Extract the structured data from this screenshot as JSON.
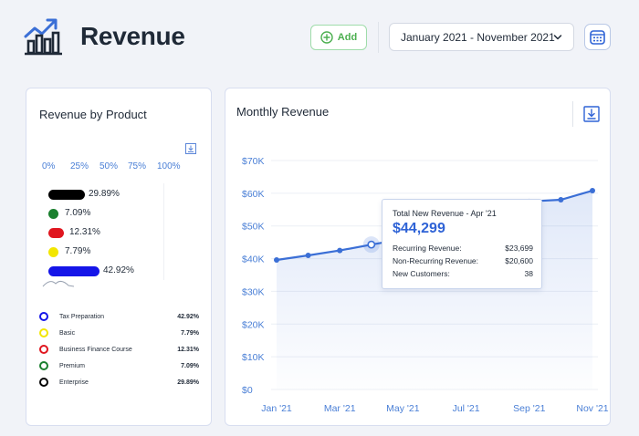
{
  "header": {
    "title": "Revenue",
    "add_label": "Add",
    "date_range": "January 2021 - November 2021"
  },
  "revenue_by_product": {
    "title": "Revenue by Product",
    "scale": [
      "0%",
      "25%",
      "50%",
      "75%",
      "100%"
    ],
    "bars": [
      {
        "label": "29.89%",
        "value": 29.89,
        "color": "#000000"
      },
      {
        "label": "7.09%",
        "value": 7.09,
        "color": "#1a7f2e"
      },
      {
        "label": "12.31%",
        "value": 12.31,
        "color": "#e0161f"
      },
      {
        "label": "7.79%",
        "value": 7.79,
        "color": "#f2e600"
      },
      {
        "label": "42.92%",
        "value": 42.92,
        "color": "#1515e8"
      }
    ],
    "legend": [
      {
        "name": "Tax Preparation",
        "value": "42.92%",
        "color": "#1515e8"
      },
      {
        "name": "Basic",
        "value": "7.79%",
        "color": "#f2e600"
      },
      {
        "name": "Business Finance Course",
        "value": "12.31%",
        "color": "#e0161f"
      },
      {
        "name": "Premium",
        "value": "7.09%",
        "color": "#1a7f2e"
      },
      {
        "name": "Enterprise",
        "value": "29.89%",
        "color": "#000000"
      }
    ]
  },
  "monthly_revenue": {
    "title": "Monthly Revenue",
    "tooltip": {
      "title": "Total New Revenue - Apr '21",
      "value": "$44,299",
      "rows": [
        {
          "label": "Recurring Revenue:",
          "value": "$23,699"
        },
        {
          "label": "Non-Recurring Revenue:",
          "value": "$20,600"
        },
        {
          "label": "New Customers:",
          "value": "38"
        }
      ]
    }
  },
  "chart_data": {
    "type": "area",
    "title": "Monthly Revenue",
    "x": [
      "Jan '21",
      "Feb '21",
      "Mar '21",
      "Apr '21",
      "May '21",
      "Jun '21",
      "Jul '21",
      "Aug '21",
      "Sep '21",
      "Oct '21",
      "Nov '21"
    ],
    "x_tick_labels": [
      "Jan '21",
      "Mar '21",
      "May '21",
      "Jul '21",
      "Sep '21",
      "Nov '21"
    ],
    "y_tick_labels": [
      "$0",
      "$10K",
      "$20K",
      "$30K",
      "$40K",
      "$50K",
      "$60K",
      "$70K"
    ],
    "values": [
      39600,
      41000,
      42500,
      44299,
      46000,
      48500,
      51000,
      54000,
      57500,
      58000,
      60800
    ],
    "highlight_index": 3,
    "ylim": [
      0,
      70000
    ],
    "grid": true,
    "color": "#3b6fd6"
  }
}
